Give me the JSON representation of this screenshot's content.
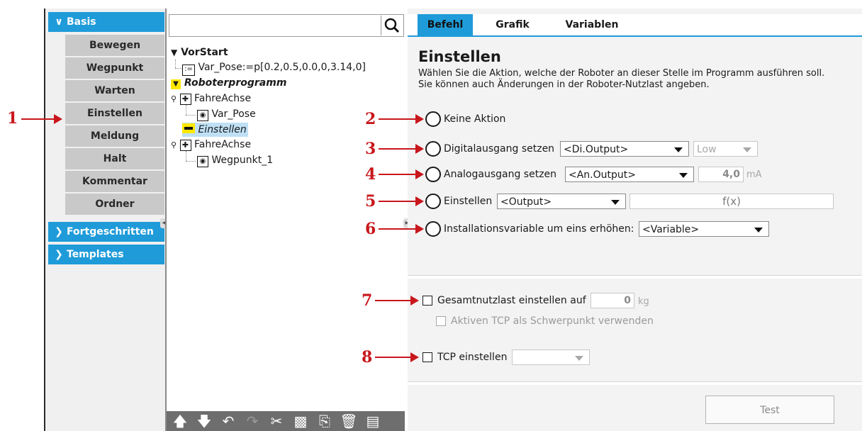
{
  "categories": {
    "basis": {
      "label": "Basis"
    },
    "fortgeschritten": {
      "label": "Fortgeschritten"
    },
    "templates": {
      "label": "Templates"
    }
  },
  "commands": [
    "Bewegen",
    "Wegpunkt",
    "Warten",
    "Einstellen",
    "Meldung",
    "Halt",
    "Kommentar",
    "Ordner"
  ],
  "tree": {
    "vorstart": "VorStart",
    "var_pose_assign": "Var_Pose:=p[0.2,0.5,0.0,0,3.14,0]",
    "roboterprogramm": "Roboterprogramm",
    "fahreachse1": "FahreAchse",
    "var_pose": "Var_Pose",
    "einstellen": "Einstellen",
    "fahreachse2": "FahreAchse",
    "wegpunkt1": "Wegpunkt_1"
  },
  "tabs": {
    "befehl": "Befehl",
    "grafik": "Grafik",
    "variablen": "Variablen"
  },
  "main": {
    "title": "Einstellen",
    "description_1": "Wählen Sie die Aktion, welche der Roboter an dieser Stelle im Programm ausführen soll.",
    "description_2": "Sie können auch Änderungen in der Roboter-Nutzlast angeben."
  },
  "options": {
    "keine_aktion": "Keine Aktion",
    "digital_label": "Digitalausgang setzen",
    "digital_select": "<Di.Output>",
    "digital_level": "Low",
    "analog_label": "Analogausgang setzen",
    "analog_select": "<An.Output>",
    "analog_value": "4,0",
    "analog_unit": "mA",
    "einstellen_label": "Einstellen",
    "einstellen_select": "<Output>",
    "einstellen_expr": "f(x)",
    "install_label": "Installationsvariable um eins erhöhen:",
    "install_select": "<Variable>"
  },
  "payload": {
    "label": "Gesamtnutzlast einstellen auf",
    "value": "0",
    "unit": "kg",
    "tcp_cog_label": "Aktiven TCP als Schwerpunkt verwenden"
  },
  "tcp": {
    "label": "TCP einstellen",
    "select": ""
  },
  "test_button": "Test",
  "callouts": [
    "1",
    "2",
    "3",
    "4",
    "5",
    "6",
    "7",
    "8"
  ],
  "colors": {
    "accent": "#1f9bd9",
    "callout": "#c8171c",
    "selected": "#bfe0f5",
    "folder_mark": "#ffe800"
  }
}
